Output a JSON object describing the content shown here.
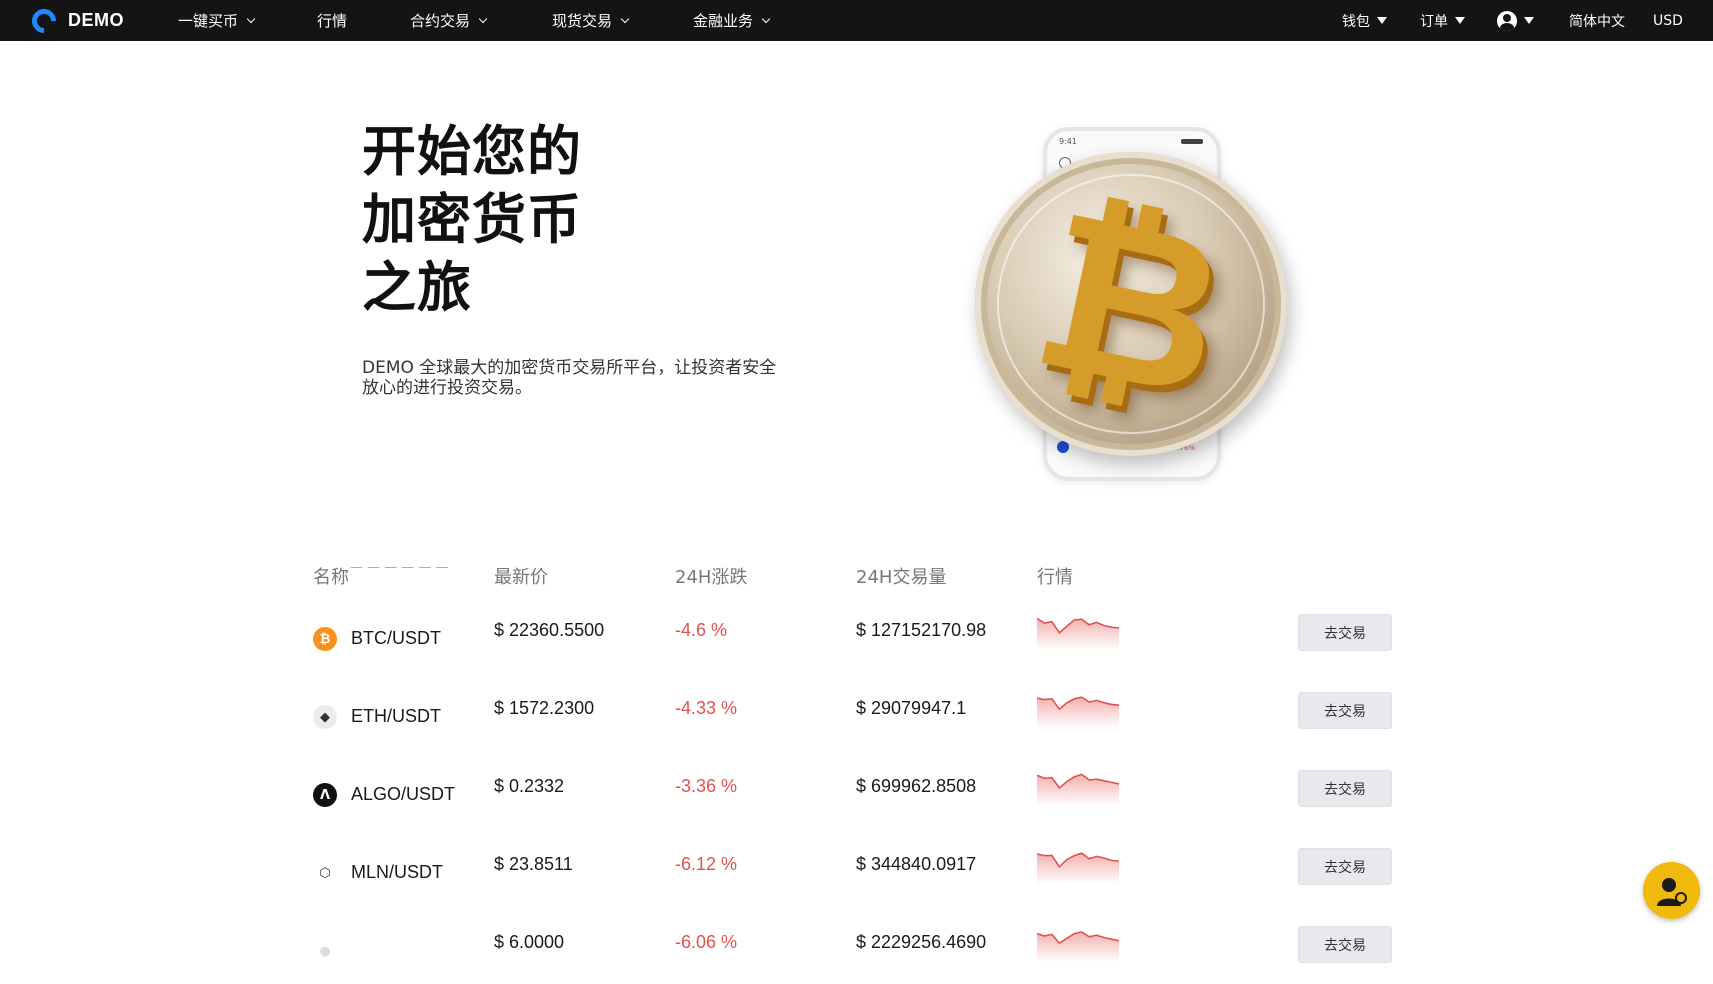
{
  "header": {
    "brand": "DEMO",
    "nav": [
      {
        "label": "一键买币",
        "dropdown": true
      },
      {
        "label": "行情",
        "dropdown": false
      },
      {
        "label": "合约交易",
        "dropdown": true
      },
      {
        "label": "现货交易",
        "dropdown": true
      },
      {
        "label": "金融业务",
        "dropdown": true
      }
    ],
    "right": {
      "wallet": "钱包",
      "orders": "订单",
      "language": "简体中文",
      "currency": "USD"
    }
  },
  "hero": {
    "title_lines": [
      "开始您的",
      "加密货币",
      "之旅"
    ],
    "subtitle": "DEMO 全球最大的加密货币交易所平台，让投资者安全放心的进行投资交易。",
    "phone": {
      "time": "9:41",
      "change": "-0.76%"
    }
  },
  "market": {
    "headers": {
      "name": "名称",
      "price": "最新价",
      "change": "24H涨跌",
      "volume": "24H交易量",
      "trend": "行情"
    },
    "trade_label": "去交易",
    "rows": [
      {
        "pair": "BTC/USDT",
        "price": "$ 22360.5500",
        "change": "-4.6 %",
        "volume": "$ 127152170.98",
        "icon": "bitcoin-icon",
        "icon_color": "#f7931a",
        "spark": [
          8,
          14,
          12,
          26,
          18,
          10,
          9,
          16,
          13,
          17,
          19,
          20
        ]
      },
      {
        "pair": "ETH/USDT",
        "price": "$ 1572.2300",
        "change": "-4.33 %",
        "volume": "$ 29079947.1",
        "icon": "ethereum-icon",
        "icon_color": "#ececec",
        "spark": [
          10,
          12,
          11,
          24,
          16,
          11,
          9,
          15,
          13,
          16,
          18,
          19
        ]
      },
      {
        "pair": "ALGO/USDT",
        "price": "$ 0.2332",
        "change": "-3.36 %",
        "volume": "$ 699962.8508",
        "icon": "algorand-icon",
        "icon_color": "#111111",
        "spark": [
          9,
          13,
          12,
          25,
          17,
          11,
          8,
          15,
          14,
          16,
          18,
          20
        ]
      },
      {
        "pair": "MLN/USDT",
        "price": "$ 23.8511",
        "change": "-6.12 %",
        "volume": "$ 344840.0917",
        "icon": "melon-icon",
        "icon_color": "#ffffff",
        "spark": [
          10,
          12,
          12,
          26,
          17,
          12,
          9,
          16,
          13,
          15,
          18,
          19
        ]
      },
      {
        "pair": "",
        "price": "$ 6.0000",
        "change": "-6.06 %",
        "volume": "$ 2229256.4690",
        "icon": "coin-icon",
        "icon_color": "#ffffff",
        "spark": [
          12,
          15,
          13,
          24,
          18,
          12,
          10,
          16,
          14,
          17,
          19,
          21
        ]
      }
    ]
  },
  "colors": {
    "down": "#e0524f",
    "accent": "#1f86ff",
    "support": "#f0b90b"
  }
}
